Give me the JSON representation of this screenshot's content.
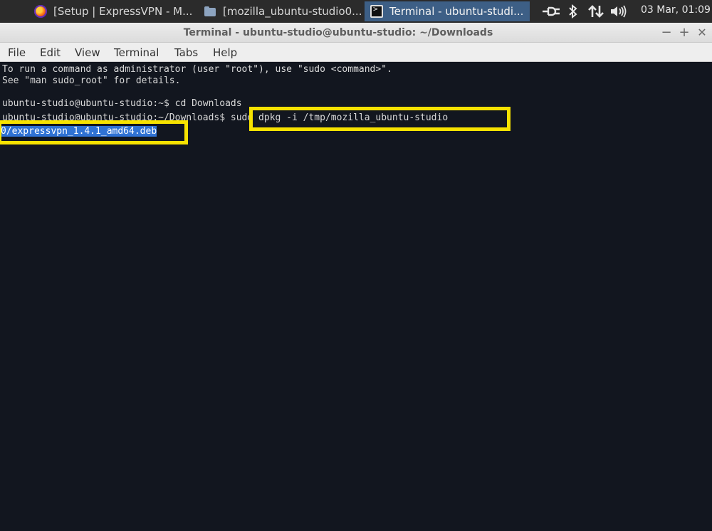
{
  "panel": {
    "tasks": [
      {
        "label": "[Setup | ExpressVPN - M...",
        "icon": "firefox-icon"
      },
      {
        "label": "[mozilla_ubuntu-studio0...",
        "icon": "folder-icon"
      },
      {
        "label": "Terminal - ubuntu-studi...",
        "icon": "terminal-icon"
      }
    ],
    "clock": "03 Mar, 01:09",
    "tray_icons": [
      "network-wired-icon",
      "bluetooth-icon",
      "data-transfer-icon",
      "volume-icon"
    ]
  },
  "window": {
    "title": "Terminal - ubuntu-studio@ubuntu-studio: ~/Downloads",
    "controls": {
      "minimize": "−",
      "maximize": "+",
      "close": "✕"
    }
  },
  "menu": [
    "File",
    "Edit",
    "View",
    "Terminal",
    "Tabs",
    "Help"
  ],
  "terminal": {
    "lines": [
      "To run a command as administrator (user \"root\"), use \"sudo <command>\".",
      "See \"man sudo_root\" for details.",
      "",
      "ubuntu-studio@ubuntu-studio:~$ cd Downloads"
    ],
    "prompt": "ubuntu-studio@ubuntu-studio:~/Downloads$ ",
    "command": "sudo dpkg -i /tmp/mozilla_ubuntu-studio",
    "command_wrap": "0/expressvpn_1.4.1_amd64.deb"
  },
  "colors": {
    "highlight": "#f7e200",
    "selection": "#2f72d4",
    "terminal_bg": "#12161f"
  }
}
